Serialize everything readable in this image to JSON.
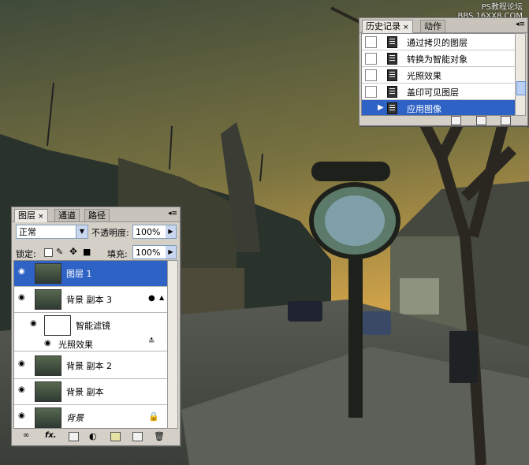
{
  "watermark": {
    "line1": "PS教程论坛",
    "line2": "BBS.16XX8.COM"
  },
  "history": {
    "tabs": [
      {
        "label": "历史记录",
        "close": "×"
      },
      {
        "label": "动作"
      }
    ],
    "items": [
      {
        "label": "通过拷贝的图层",
        "selected": false
      },
      {
        "label": "转换为智能对象",
        "selected": false
      },
      {
        "label": "光照效果",
        "selected": false
      },
      {
        "label": "盖印可见图层",
        "selected": false
      },
      {
        "label": "应用图像",
        "selected": true
      }
    ],
    "footer_icons": [
      "new-document-icon",
      "snapshot-camera-icon",
      "trash-icon"
    ]
  },
  "layers": {
    "tabs": [
      {
        "label": "图层",
        "close": "×"
      },
      {
        "label": "通道"
      },
      {
        "label": "路径"
      }
    ],
    "blend_mode": "正常",
    "opacity_label": "不透明度:",
    "opacity_value": "100%",
    "lock_label": "锁定:",
    "fill_label": "填充:",
    "fill_value": "100%",
    "items": [
      {
        "name": "图层 1",
        "selected": true
      },
      {
        "name": "背景 副本 3",
        "selected": false,
        "smart": true
      },
      {
        "name": "智能滤镜",
        "selected": false
      },
      {
        "name": "光照效果",
        "selected": false
      },
      {
        "name": "背景 副本 2",
        "selected": false
      },
      {
        "name": "背景 副本",
        "selected": false
      },
      {
        "name": "背景",
        "selected": false,
        "locked": true
      }
    ],
    "footer_icons": [
      "link-icon",
      "fx-icon",
      "mask-icon",
      "adjustment-icon",
      "folder-icon",
      "new-layer-icon",
      "trash-icon"
    ]
  },
  "colors": {
    "selection": "#2e62c4",
    "panel": "#d4d0c8",
    "sky": "#d6a64a"
  }
}
